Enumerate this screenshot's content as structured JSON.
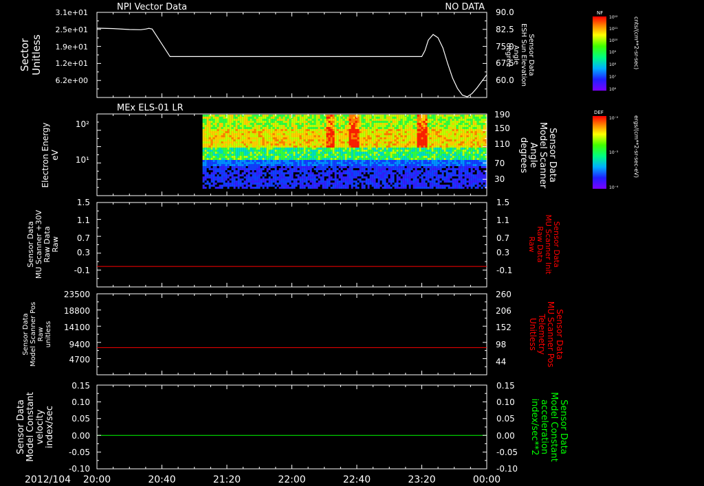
{
  "colors": {
    "background": "#000000",
    "axis": "#ffffff",
    "line_white": "#ffffff",
    "line_red": "#ff0000",
    "line_green": "#00ff00",
    "label_red": "#ff0000",
    "label_green": "#00ff00"
  },
  "time_axis": {
    "date_label": "2012/104",
    "ticks": [
      "20:00",
      "20:40",
      "21:20",
      "22:00",
      "22:40",
      "23:20",
      "00:00"
    ],
    "minutes": [
      0,
      40,
      80,
      120,
      160,
      200,
      240
    ],
    "range_minutes": [
      0,
      240
    ]
  },
  "chart_data": [
    {
      "type": "line",
      "title": "NPI Vector Data",
      "status": "NO DATA",
      "ylabel_left": [
        "Sector",
        "Unitless"
      ],
      "ylabel_right": [
        "Sensor Data",
        "ESH Sun Elevation",
        "Angle",
        "degree"
      ],
      "left_ticks": [
        "3.1e+01",
        "2.5e+01",
        "1.9e+01",
        "1.2e+01",
        "6.2e+00"
      ],
      "right_ticks": [
        "90.0",
        "82.5",
        "75.0",
        "67.5",
        "60.0"
      ],
      "right_tick_values": [
        90,
        82.5,
        75,
        67.5,
        60
      ],
      "right_ylim": [
        53.8,
        90
      ],
      "series": [
        {
          "color": "#ffffff",
          "x": [
            0,
            10,
            20,
            27,
            30,
            32,
            34,
            40,
            45,
            200,
            202,
            204,
            207,
            210,
            213,
            216,
            219,
            222,
            225,
            228,
            231,
            234,
            240
          ],
          "y": [
            83.3,
            83.1,
            82.7,
            82.6,
            82.9,
            83.2,
            82.9,
            76.5,
            71.2,
            71.2,
            73.8,
            78.2,
            80.6,
            79.2,
            74.9,
            68.1,
            62.0,
            57.6,
            54.8,
            54.1,
            55.5,
            57.9,
            63.5
          ]
        }
      ]
    },
    {
      "type": "heatmap",
      "title": "MEx ELS-01 LR",
      "ylabel_left": [
        "Electron Energy",
        "eV"
      ],
      "ylabel_right": [
        "Sensor Data",
        "Model Scanner",
        "Angle",
        "degrees"
      ],
      "left_ticks": [
        "10²",
        "10¹"
      ],
      "right_ticks": [
        "190",
        "150",
        "110",
        "70",
        "30"
      ],
      "right_tick_values": [
        190,
        150,
        110,
        70,
        30
      ],
      "right_ylim": [
        4,
        190
      ],
      "data_start_minute": 65,
      "high_flux_minutes": [
        143,
        158,
        200
      ],
      "scanner_angle_line": {
        "color": "#ffffff",
        "value": 4
      }
    },
    {
      "type": "line",
      "ylabel_left": [
        "Sensor Data",
        "MU Scanner +30V",
        "Raw Data",
        "Raw"
      ],
      "ylabel_right": [
        "Sensor Data",
        "MU Scanner Init",
        "Raw Data",
        "Raw"
      ],
      "left_ticks": [
        "1.5",
        "1.1",
        "0.7",
        "0.3",
        "-0.1"
      ],
      "right_ticks": [
        "1.5",
        "1.1",
        "0.7",
        "0.3",
        "-0.1"
      ],
      "tick_values": [
        1.5,
        1.1,
        0.7,
        0.3,
        -0.1
      ],
      "ylim": [
        -0.35,
        1.5
      ],
      "series": [
        {
          "color": "#ff0000",
          "x": [
            0,
            240
          ],
          "y": [
            0.1,
            0.1
          ]
        }
      ]
    },
    {
      "type": "line",
      "ylabel_left": [
        "Sensor Data",
        "Model Scanner Pos",
        "Raw",
        "unitless"
      ],
      "ylabel_right": [
        "Sensor Data",
        "MU Scanner Pos",
        "Telemetry",
        "Unitless"
      ],
      "left_ticks": [
        "23500",
        "18800",
        "14100",
        "9400",
        "4700"
      ],
      "left_tick_values": [
        23500,
        18800,
        14100,
        9400,
        4700
      ],
      "right_ticks": [
        "260",
        "206",
        "152",
        "98",
        "44"
      ],
      "ylim": [
        0,
        23500
      ],
      "series": [
        {
          "color": "#ff0000",
          "x": [
            0,
            240
          ],
          "y": [
            7900,
            7900
          ]
        }
      ]
    },
    {
      "type": "line",
      "ylabel_left": [
        "Sensor Data",
        "Model Constant",
        "velocity",
        "index/sec"
      ],
      "ylabel_right": [
        "Sensor Data",
        "Model Constant",
        "acceleration",
        "index/sec**2"
      ],
      "left_ticks": [
        "0.15",
        "0.10",
        "0.05",
        "0.00",
        "-0.05",
        "-0.10"
      ],
      "right_ticks": [
        "0.15",
        "0.10",
        "0.05",
        "0.00",
        "-0.05",
        "-0.10"
      ],
      "tick_values": [
        0.15,
        0.1,
        0.05,
        0.0,
        -0.05,
        -0.1
      ],
      "ylim": [
        -0.1,
        0.15
      ],
      "series": [
        {
          "color": "#00ff00",
          "x": [
            0,
            240
          ],
          "y": [
            0.0,
            0.0
          ]
        }
      ]
    }
  ],
  "colorbars": [
    {
      "label": "NF",
      "unit": "cnts/(cm**2-sr-sec)",
      "ticks": [
        "10¹²",
        "10¹¹",
        "10¹⁰",
        "10⁹",
        "10⁸",
        "10⁷",
        "10⁶"
      ]
    },
    {
      "label": "DEF",
      "unit": "ergs/(cm**2-sr-sec-eV)",
      "ticks": [
        "10⁻²",
        "10⁻³",
        "10⁻⁴"
      ]
    }
  ]
}
